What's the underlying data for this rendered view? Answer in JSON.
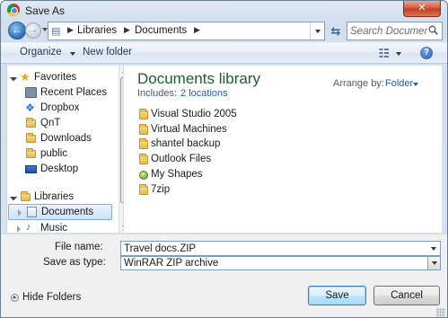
{
  "window": {
    "title": "Save As",
    "close_label": "✕"
  },
  "address": {
    "breadcrumbs": [
      "Libraries",
      "Documents"
    ],
    "search_placeholder": "Search Documents"
  },
  "toolbar": {
    "organize_label": "Organize",
    "new_folder_label": "New folder",
    "help_label": "?"
  },
  "navpane": {
    "items": [
      {
        "label": "Favorites",
        "icon": "star-icon",
        "expanded": true
      },
      {
        "label": "Recent Places",
        "icon": "recent-places-icon"
      },
      {
        "label": "Dropbox",
        "icon": "dropbox-icon"
      },
      {
        "label": "QnT",
        "icon": "folder-icon"
      },
      {
        "label": "Downloads",
        "icon": "downloads-icon"
      },
      {
        "label": "public",
        "icon": "folder-icon"
      },
      {
        "label": "Desktop",
        "icon": "desktop-icon"
      },
      {
        "label": "Libraries",
        "icon": "libraries-icon",
        "expanded": true
      },
      {
        "label": "Documents",
        "icon": "documents-library-icon",
        "selected": true
      },
      {
        "label": "Music",
        "icon": "music-icon"
      }
    ]
  },
  "content": {
    "library_title": "Documents library",
    "includes_label": "Includes:",
    "includes_link": "2 locations",
    "arrange_label": "Arrange by:",
    "arrange_value": "Folder",
    "items": [
      {
        "name": "Visual Studio 2005",
        "icon": "folder-icon"
      },
      {
        "name": "Virtual Machines",
        "icon": "folder-icon"
      },
      {
        "name": "shantel backup",
        "icon": "folder-icon"
      },
      {
        "name": "Outlook Files",
        "icon": "folder-icon"
      },
      {
        "name": "My Shapes",
        "icon": "shapes-folder-icon"
      },
      {
        "name": "7zip",
        "icon": "folder-icon"
      }
    ]
  },
  "form": {
    "filename_label": "File name:",
    "filename_value": "Travel docs.ZIP",
    "filetype_label": "Save as type:",
    "filetype_value": "WinRAR ZIP archive",
    "hide_folders_label": "Hide Folders",
    "save_label": "Save",
    "cancel_label": "Cancel"
  },
  "colors": {
    "library_title": "#1e5e2e",
    "link": "#0d66c2",
    "close_button": "#c23b1f",
    "selection": "#cde3fa"
  }
}
